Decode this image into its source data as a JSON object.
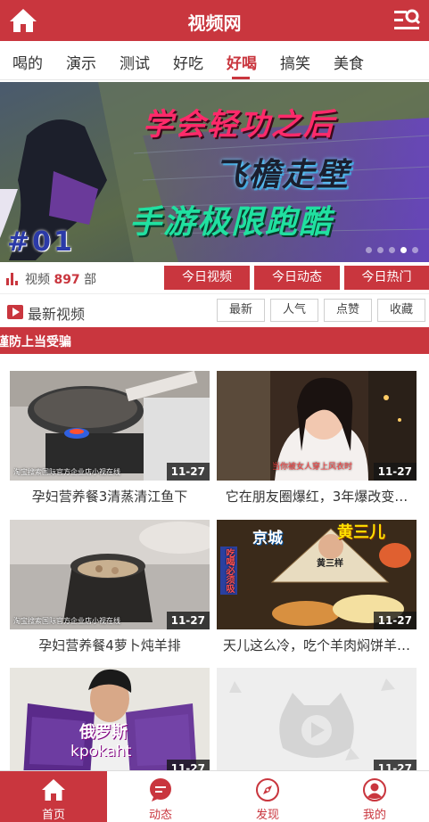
{
  "header": {
    "title": "视频网",
    "home_icon": "home-icon",
    "menu_icon": "list-search-icon"
  },
  "tabs": [
    {
      "label": "喝的"
    },
    {
      "label": "演示"
    },
    {
      "label": "测试"
    },
    {
      "label": "好吃"
    },
    {
      "label": "好喝"
    },
    {
      "label": "搞笑"
    },
    {
      "label": "美食"
    }
  ],
  "active_tab": "好喝",
  "banner": {
    "line1": "学会轻功之后",
    "line2": "飞檐走壁",
    "line3": "手游极限跑酷",
    "episode": "#01",
    "slide_count": 5,
    "active_slide": 4
  },
  "stats": {
    "prefix": "视频",
    "count": "897",
    "suffix": "部",
    "buttons": [
      "今日视频",
      "今日动态",
      "今日热门"
    ]
  },
  "latest": {
    "title": "最新视频",
    "filters": [
      "最新",
      "人气",
      "点赞",
      "收藏"
    ]
  },
  "notice": "谨防上当受骗",
  "videos": [
    {
      "title": "孕妇营养餐3清蒸清江鱼下",
      "date": "11-27"
    },
    {
      "title": "它在朋友圈爆红，3年爆改变…",
      "date": "11-27"
    },
    {
      "title": "孕妇营养餐4萝卜炖羊排",
      "date": "11-27"
    },
    {
      "title": "天儿这么冷，吃个羊肉焖饼羊…",
      "date": "11-27"
    },
    {
      "title": "",
      "date": "11-27"
    },
    {
      "title": "",
      "date": "11-27"
    }
  ],
  "thumb_text": {
    "v2_caption": "当你被女人穿上风衣时",
    "v4_left": "京城",
    "v4_right": "黄三儿",
    "v4_fan": "黄三样",
    "v4_badge": "吃喝必须吸",
    "v5_caption_top": "俄罗斯",
    "v5_caption_bottom": "kpokaht",
    "watermark": "淘宝搜索国际官方企业店小视在线",
    "watermark_tag": "授权代理 版权代理"
  },
  "bottom_nav": [
    {
      "label": "首页",
      "icon": "home-icon"
    },
    {
      "label": "动态",
      "icon": "chat-icon"
    },
    {
      "label": "发现",
      "icon": "compass-icon"
    },
    {
      "label": "我的",
      "icon": "user-icon"
    }
  ],
  "colors": {
    "brand": "#c9363e"
  }
}
